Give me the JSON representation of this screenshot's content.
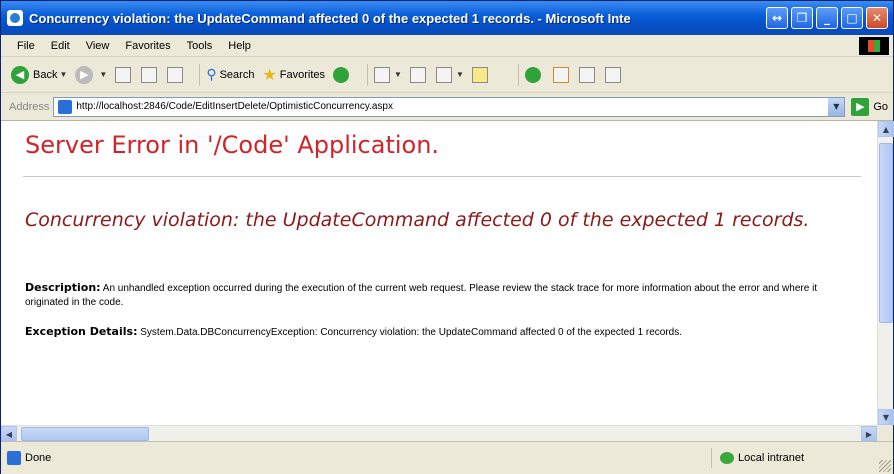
{
  "window": {
    "title": "Concurrency violation: the UpdateCommand affected 0 of the expected 1 records. - Microsoft Inte",
    "buttons": [
      "↔",
      "❐",
      "_",
      "□",
      "✕"
    ]
  },
  "menu": [
    "File",
    "Edit",
    "View",
    "Favorites",
    "Tools",
    "Help"
  ],
  "toolbar": {
    "back_label": "Back",
    "search_label": "Search",
    "favorites_label": "Favorites"
  },
  "address": {
    "label": "Address",
    "url": "http://localhost:2846/Code/EditInsertDelete/OptimisticConcurrency.aspx",
    "go_label": "Go"
  },
  "content": {
    "error_title": "Server Error in '/Code' Application.",
    "error_message": "Concurrency violation: the UpdateCommand affected 0 of the expected 1 records.",
    "description_label": "Description:",
    "description_text": " An unhandled exception occurred during the execution of the current web request. Please review the stack trace for more information about the error and where it originated in the code.",
    "exception_label": "Exception Details:",
    "exception_text": " System.Data.DBConcurrencyException: Concurrency violation: the UpdateCommand affected 0 of the expected 1 records."
  },
  "status": {
    "text": "Done",
    "zone": "Local intranet"
  },
  "colors": {
    "error_title": "#d2232a",
    "error_message": "#8b1a1a",
    "titlebar": "#0550c8"
  }
}
